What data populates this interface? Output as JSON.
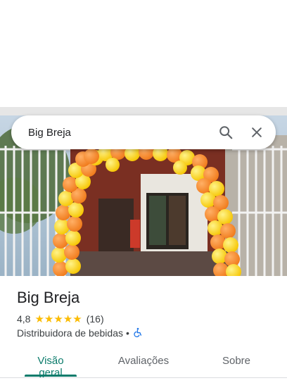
{
  "search": {
    "query": "Big Breja"
  },
  "place": {
    "name": "Big Breja",
    "rating": "4,8",
    "stars": 5,
    "review_count": "(16)",
    "category": "Distribuidora de bebidas",
    "separator": "•"
  },
  "tabs": [
    {
      "label": "Visão geral",
      "active": true
    },
    {
      "label": "Avaliações",
      "active": false
    },
    {
      "label": "Sobre",
      "active": false
    }
  ],
  "icons": {
    "search": "search-icon",
    "clear": "close-icon",
    "accessibility": "wheelchair-icon"
  },
  "colors": {
    "accent": "#0b7b6b",
    "star": "#fbbc04",
    "accessibility": "#1a73e8"
  }
}
